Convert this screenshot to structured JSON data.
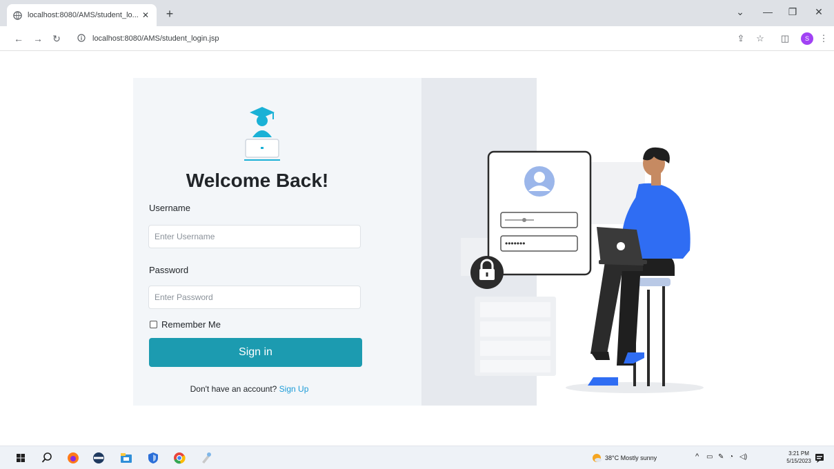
{
  "browser": {
    "tab_title": "localhost:8080/AMS/student_lo...",
    "new_tab": "+",
    "url": "localhost:8080/AMS/student_login.jsp",
    "profile_initial": "S"
  },
  "login": {
    "heading": "Welcome Back!",
    "username_label": "Username",
    "username_placeholder": "Enter Username",
    "password_label": "Password",
    "password_placeholder": "Enter Password",
    "remember_label": "Remember Me",
    "signin_label": "Sign in",
    "signup_prompt": "Don't have an account?",
    "signup_link": "Sign Up",
    "illustration_password_mask": "•••••••"
  },
  "taskbar": {
    "weather": "38°C  Mostly sunny",
    "time": "3:21 PM",
    "date": "5/15/2023"
  },
  "colors": {
    "accent": "#1c9bb0",
    "link": "#1d9cd8",
    "panel": "#f3f6f9",
    "person_shirt": "#2f6df3"
  }
}
